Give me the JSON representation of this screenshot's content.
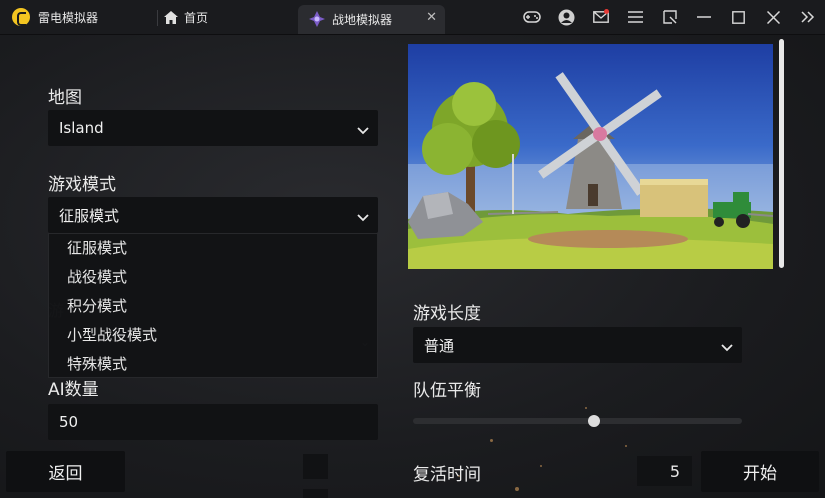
{
  "titlebar": {
    "app_title": "雷电模拟器",
    "home_tab": "首页",
    "game_tab": "战地模拟器",
    "tab_close": "✕"
  },
  "form": {
    "map_label": "地图",
    "map_value": "Island",
    "mode_label": "游戏模式",
    "mode_value": "征服模式",
    "mode_options": [
      "征服模式",
      "战役模式",
      "积分模式",
      "小型战役模式",
      "特殊模式"
    ],
    "ai_label": "AI数量",
    "ai_value": "50",
    "length_label": "游戏长度",
    "length_value": "普通",
    "balance_label": "队伍平衡",
    "balance_level": 0.55,
    "respawn_label": "复活时间",
    "respawn_value": "5"
  },
  "buttons": {
    "back": "返回",
    "start": "开始"
  },
  "colors": {
    "accent": "#f3c521",
    "notification": "#e53935",
    "panel": "#111214"
  }
}
